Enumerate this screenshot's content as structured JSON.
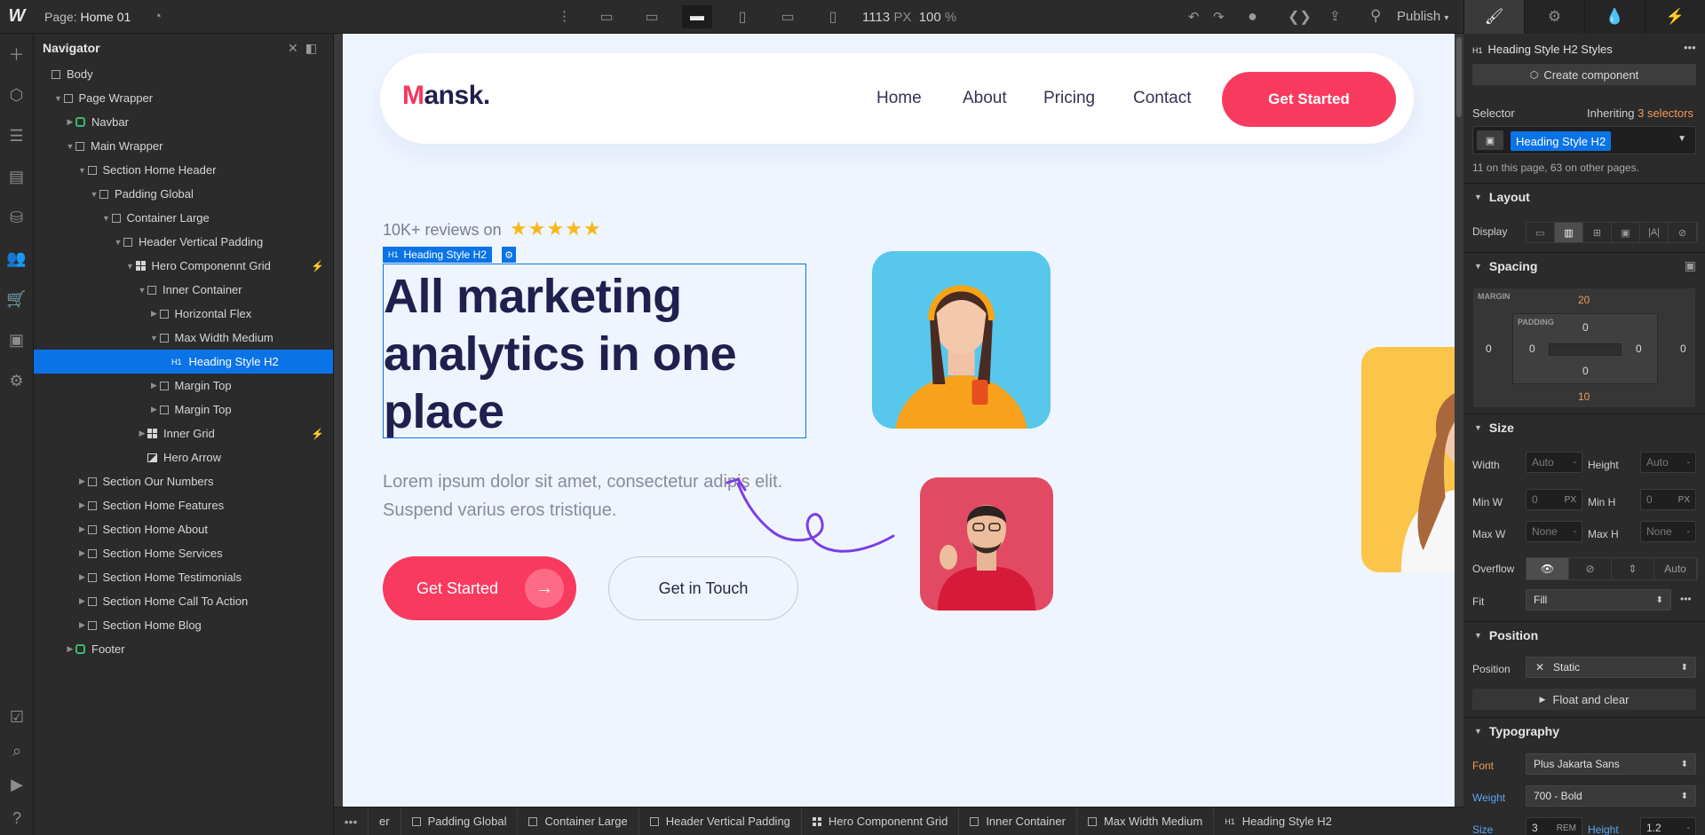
{
  "topbar": {
    "logo": "W",
    "page_prefix": "Page:",
    "page_name": "Home 01",
    "width_value": "1113",
    "width_unit": "PX",
    "zoom": "100",
    "zoom_unit": "%",
    "publish": "Publish"
  },
  "navigator": {
    "title": "Navigator",
    "items": [
      {
        "label": "Body",
        "depth": 0,
        "icon": "box",
        "caret": ""
      },
      {
        "label": "Page Wrapper",
        "depth": 1,
        "icon": "box",
        "caret": "open"
      },
      {
        "label": "Navbar",
        "depth": 2,
        "icon": "component",
        "caret": "closed"
      },
      {
        "label": "Main Wrapper",
        "depth": 2,
        "icon": "box",
        "caret": "open"
      },
      {
        "label": "Section Home Header",
        "depth": 3,
        "icon": "box",
        "caret": "open"
      },
      {
        "label": "Padding Global",
        "depth": 4,
        "icon": "box",
        "caret": "open"
      },
      {
        "label": "Container Large",
        "depth": 5,
        "icon": "box",
        "caret": "open"
      },
      {
        "label": "Header Vertical Padding",
        "depth": 6,
        "icon": "box",
        "caret": "open"
      },
      {
        "label": "Hero Componennt Grid",
        "depth": 7,
        "icon": "grid",
        "caret": "open",
        "bolt": true
      },
      {
        "label": "Inner Container",
        "depth": 8,
        "icon": "box",
        "caret": "open"
      },
      {
        "label": "Horizontal Flex",
        "depth": 9,
        "icon": "box",
        "caret": "closed"
      },
      {
        "label": "Max Width Medium",
        "depth": 9,
        "icon": "box",
        "caret": "open"
      },
      {
        "label": "Heading Style H2",
        "depth": 10,
        "icon": "h1",
        "caret": "",
        "selected": true
      },
      {
        "label": "Margin Top",
        "depth": 9,
        "icon": "box",
        "caret": "closed"
      },
      {
        "label": "Margin Top",
        "depth": 9,
        "icon": "box",
        "caret": "closed"
      },
      {
        "label": "Inner Grid",
        "depth": 8,
        "icon": "grid",
        "caret": "closed",
        "bolt": true
      },
      {
        "label": "Hero Arrow",
        "depth": 8,
        "icon": "image",
        "caret": ""
      },
      {
        "label": "Section Our Numbers",
        "depth": 3,
        "icon": "box",
        "caret": "closed"
      },
      {
        "label": "Section Home Features",
        "depth": 3,
        "icon": "box",
        "caret": "closed"
      },
      {
        "label": "Section Home About",
        "depth": 3,
        "icon": "box",
        "caret": "closed"
      },
      {
        "label": "Section Home Services",
        "depth": 3,
        "icon": "box",
        "caret": "closed"
      },
      {
        "label": "Section Home Testimonials",
        "depth": 3,
        "icon": "box",
        "caret": "closed"
      },
      {
        "label": "Section Home Call To Action",
        "depth": 3,
        "icon": "box",
        "caret": "closed"
      },
      {
        "label": "Section Home Blog",
        "depth": 3,
        "icon": "box",
        "caret": "closed"
      },
      {
        "label": "Footer",
        "depth": 2,
        "icon": "component",
        "caret": "closed"
      }
    ]
  },
  "site": {
    "brand_initial": "M",
    "brand_rest": "ansk.",
    "menu": [
      "Home",
      "About",
      "Pricing",
      "Contact"
    ],
    "nav_cta": "Get Started",
    "reviews": "10K+ reviews on",
    "stars": "★★★★★",
    "selection_tag": "Heading Style H2",
    "headline": "All marketing analytics in one place",
    "lorem": "Lorem ipsum dolor sit amet, consectetur adipis elit. Suspend varius eros tristique.",
    "primary_btn": "Get Started",
    "secondary_btn": "Get in Touch",
    "colors": {
      "accent": "#f93a5f",
      "heading": "#211f4e",
      "bg": "#eef5ff"
    }
  },
  "breadcrumbs": [
    "er",
    "Padding Global",
    "Container Large",
    "Header Vertical Padding",
    "Hero Componennt Grid",
    "Inner Container",
    "Max Width Medium",
    "Heading Style H2"
  ],
  "style_panel": {
    "element_title": "Heading Style H2 Styles",
    "create_component": "Create component",
    "selector_label": "Selector",
    "inheriting_prefix": "Inheriting",
    "inheriting_count": "3 selectors",
    "selector_chip": "Heading Style H2",
    "usage": "11 on this page, 63 on other pages.",
    "layout_title": "Layout",
    "display_label": "Display",
    "spacing_title": "Spacing",
    "margin_label": "MARGIN",
    "padding_label": "PADDING",
    "margin": {
      "top": "20",
      "right": "0",
      "bottom": "10",
      "left": "0"
    },
    "padding": {
      "top": "0",
      "right": "0",
      "bottom": "0",
      "left": "0"
    },
    "size_title": "Size",
    "width_label": "Width",
    "width_val": "Auto",
    "width_unit": "-",
    "height_label": "Height",
    "height_val": "Auto",
    "height_unit": "-",
    "minw_label": "Min W",
    "minw_val": "0",
    "minw_unit": "PX",
    "minh_label": "Min H",
    "minh_val": "0",
    "minh_unit": "PX",
    "maxw_label": "Max W",
    "maxw_val": "None",
    "maxw_unit": "-",
    "maxh_label": "Max H",
    "maxh_val": "None",
    "maxh_unit": "-",
    "overflow_label": "Overflow",
    "overflow_auto": "Auto",
    "fit_label": "Fit",
    "fit_value": "Fill",
    "position_title": "Position",
    "position_label": "Position",
    "position_value": "Static",
    "float_clear": "Float and clear",
    "typography_title": "Typography",
    "font_label": "Font",
    "font_value": "Plus Jakarta Sans",
    "weight_label": "Weight",
    "weight_value": "700 - Bold",
    "size_label": "Size",
    "size_value": "3",
    "size_unit": "REM",
    "lineheight_label": "Height",
    "lineheight_value": "1.2"
  }
}
